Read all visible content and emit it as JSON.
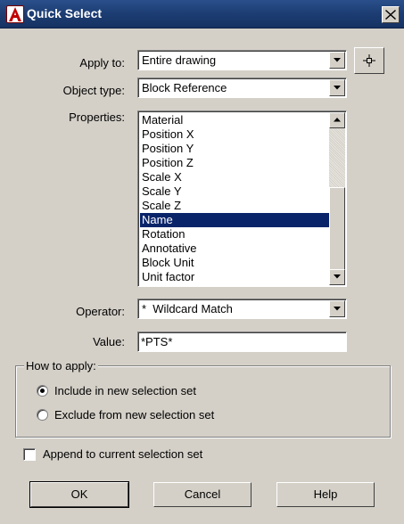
{
  "window": {
    "title": "Quick Select",
    "icon": "autocad-a-icon",
    "close_icon": "close-x-icon"
  },
  "apply_to": {
    "label": "Apply to:",
    "value": "Entire drawing",
    "pick_button_icon": "select-objects-crosshair-icon"
  },
  "object_type": {
    "label": "Object type:",
    "value": "Block Reference"
  },
  "properties": {
    "label": "Properties:",
    "items": [
      "Material",
      "Position X",
      "Position Y",
      "Position Z",
      "Scale X",
      "Scale Y",
      "Scale Z",
      "Name",
      "Rotation",
      "Annotative",
      "Block Unit",
      "Unit factor"
    ],
    "selected": "Name"
  },
  "operator": {
    "label": "Operator:",
    "value": "*  Wildcard Match"
  },
  "value": {
    "label": "Value:",
    "value": "*PTS*"
  },
  "how_to_apply": {
    "legend": "How to apply:",
    "options": [
      {
        "label": "Include in new selection set",
        "checked": true
      },
      {
        "label": "Exclude from new selection set",
        "checked": false
      }
    ]
  },
  "append": {
    "label": "Append to current selection set",
    "checked": false
  },
  "buttons": {
    "ok": "OK",
    "cancel": "Cancel",
    "help": "Help"
  },
  "colors": {
    "titlebar": "#1c3d73",
    "dialog_bg": "#d4d0c8",
    "selection": "#0a246a"
  }
}
